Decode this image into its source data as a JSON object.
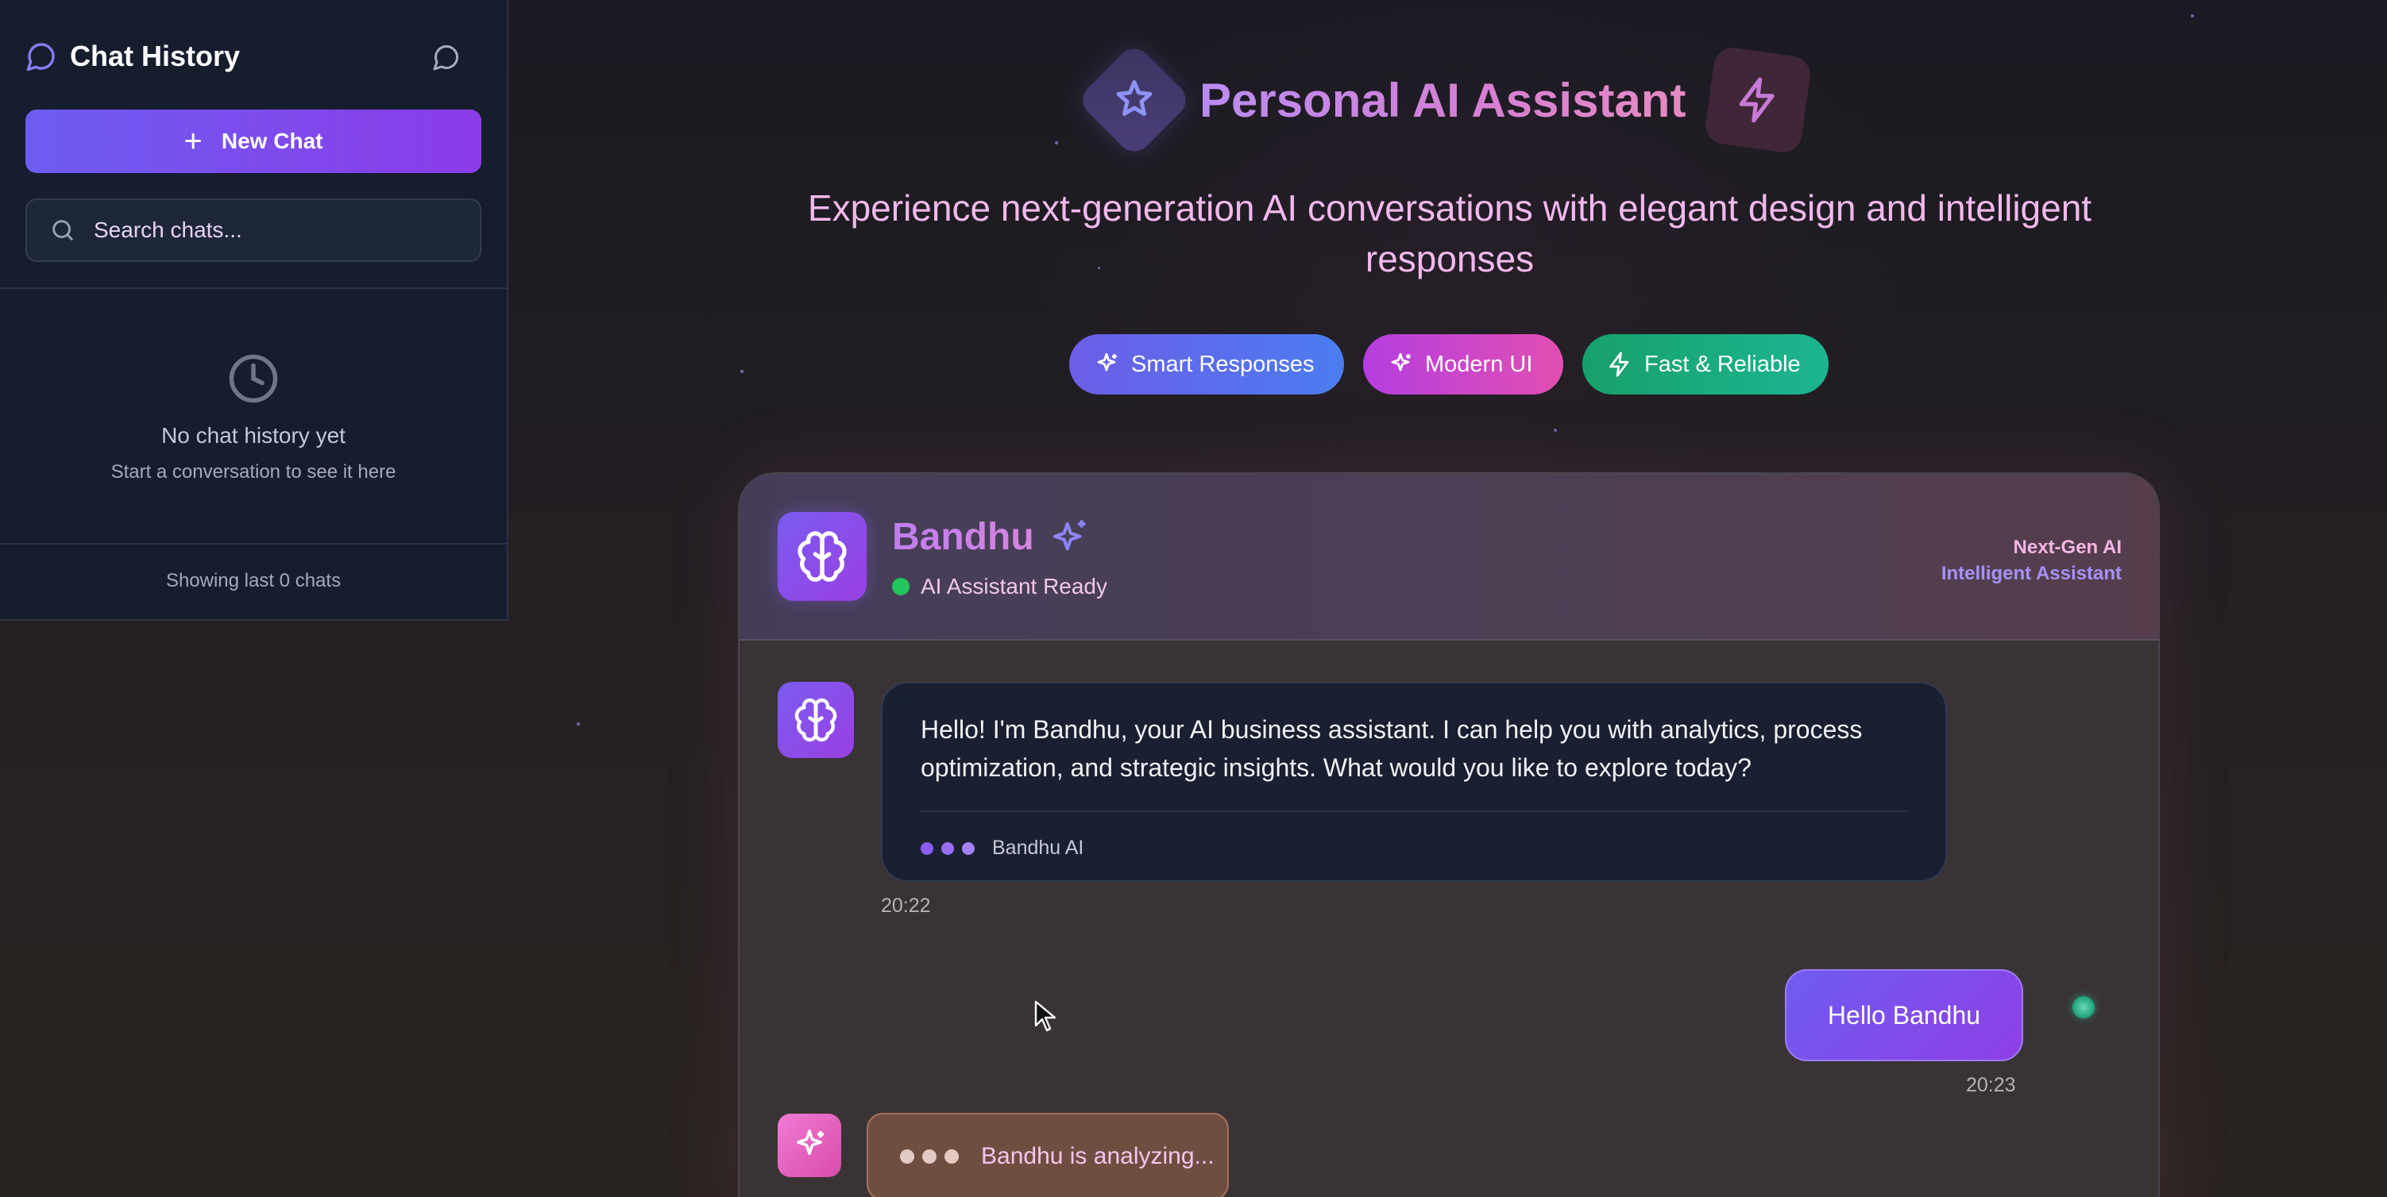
{
  "sidebar": {
    "title": "Chat History",
    "new_chat_label": "New Chat",
    "search_placeholder": "Search chats...",
    "empty_title": "No chat history yet",
    "empty_subtitle": "Start a conversation to see it here",
    "footer": "Showing last 0 chats"
  },
  "header": {
    "title": "Personal AI Assistant",
    "subtitle": "Experience next-generation AI conversations with elegant design and intelligent responses",
    "pills": [
      {
        "label": "Smart Responses"
      },
      {
        "label": "Modern UI"
      },
      {
        "label": "Fast & Reliable"
      }
    ]
  },
  "chat": {
    "bot_name": "Bandhu",
    "status": "AI Assistant Ready",
    "tag_line_1": "Next-Gen AI",
    "tag_line_2": "Intelligent Assistant",
    "messages": [
      {
        "role": "assistant",
        "text": "Hello! I'm Bandhu, your AI business assistant. I can help you with analytics, process optimization, and strategic insights. What would you like to explore today?",
        "signature": "Bandhu AI",
        "time": "20:22"
      },
      {
        "role": "user",
        "text": "Hello Bandhu",
        "time": "20:23"
      }
    ],
    "typing_text": "Bandhu is analyzing..."
  },
  "colors": {
    "accent_purple": "#7a5cf0",
    "accent_pink": "#e24fb1",
    "accent_green": "#1cb592",
    "status_green": "#22c55e"
  },
  "icons": [
    "chat-bubble-icon",
    "new-chat-icon",
    "plus-icon",
    "search-icon",
    "clock-icon",
    "sparkle-icon",
    "bolt-icon",
    "brain-icon"
  ]
}
